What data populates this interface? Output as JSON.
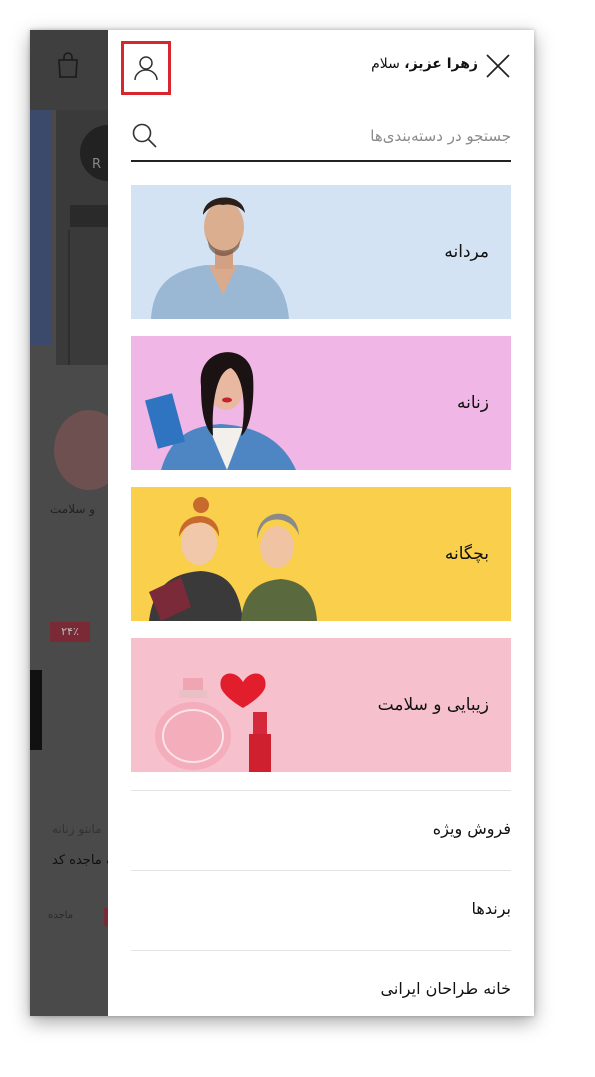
{
  "background_page": {
    "category_label": "و سلامت",
    "price_badge": "۲۴٪",
    "product_line1": "مانتو زنانه",
    "product_line2": "مانتو زنانه ماجده کد",
    "product_brand": "ماجده"
  },
  "drawer": {
    "greeting_name": "زهرا عزیز،",
    "greeting_suffix": "سلام",
    "search": {
      "placeholder": "جستجو در دسته‌بندی‌ها"
    },
    "categories": [
      {
        "label": "مردانه",
        "color": "#d3e3f4"
      },
      {
        "label": "زنانه",
        "color": "#f0b6e6"
      },
      {
        "label": "بچگانه",
        "color": "#f9cf4c"
      },
      {
        "label": "زیبایی و سلامت",
        "color": "#f6c1cd"
      }
    ],
    "menu": [
      {
        "label": "فروش ویژه"
      },
      {
        "label": "برندها"
      },
      {
        "label": "خانه طراحان ایرانی"
      }
    ]
  },
  "colors": {
    "highlight": "#d7262e",
    "overlay": "#4a4a4a"
  }
}
